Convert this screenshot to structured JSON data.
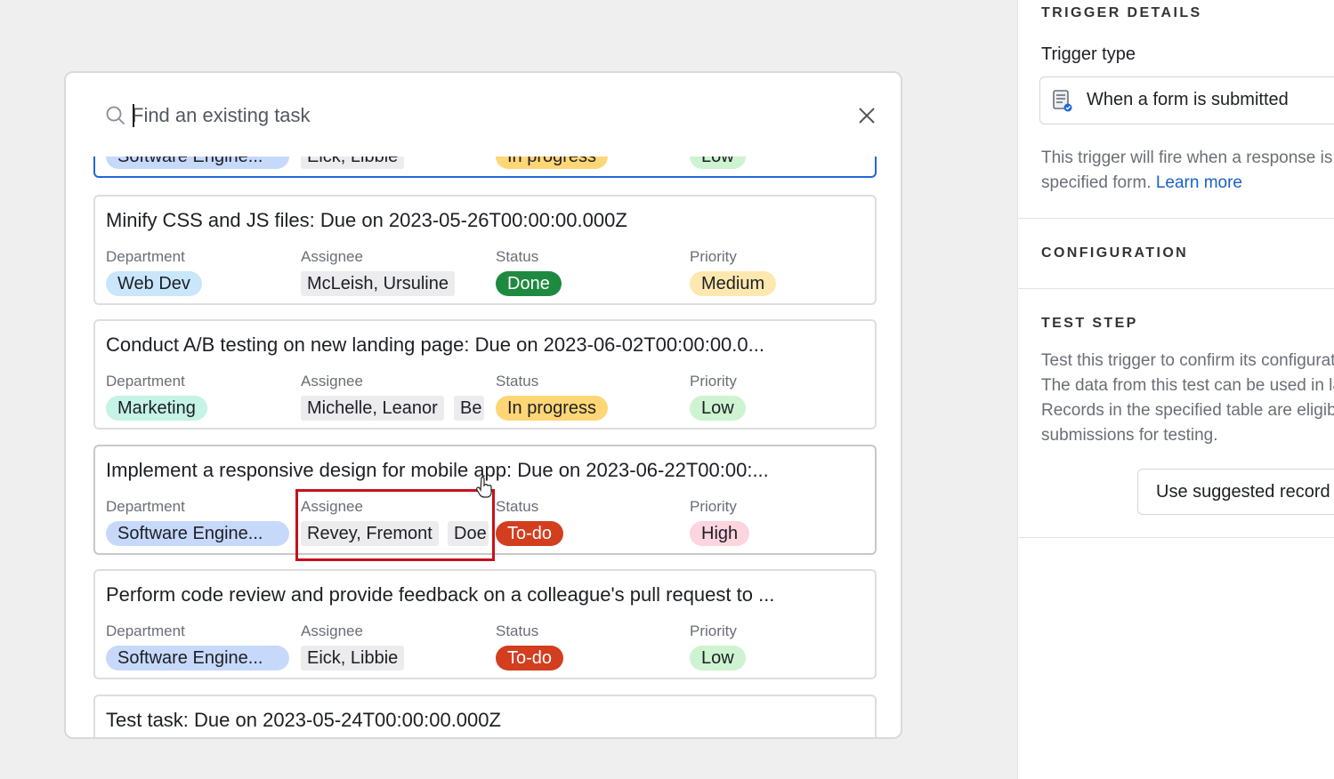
{
  "modal": {
    "search_placeholder": "Find an existing task",
    "tasks": [
      {
        "title": "",
        "department": "Software Engine...",
        "assignee": "Eick, Libbie",
        "assignee_more": "",
        "status": "In progress",
        "priority": "Low"
      },
      {
        "title": "Minify CSS and JS files: Due on 2023-05-26T00:00:00.000Z",
        "department": "Web Dev",
        "assignee": "McLeish, Ursuline",
        "assignee_more": "",
        "status": "Done",
        "priority": "Medium"
      },
      {
        "title": "Conduct A/B testing on new landing page: Due on 2023-06-02T00:00:00.0...",
        "department": "Marketing",
        "assignee": "Michelle, Leanor",
        "assignee_more": "Be",
        "status": "In progress",
        "priority": "Low"
      },
      {
        "title": "Implement a responsive design for mobile app: Due on 2023-06-22T00:00:...",
        "department": "Software Engine...",
        "assignee": "Revey, Fremont",
        "assignee_more": "Doe",
        "status": "To-do",
        "priority": "High"
      },
      {
        "title": "Perform code review and provide feedback on a colleague's pull request to ...",
        "department": "Software Engine...",
        "assignee": "Eick, Libbie",
        "assignee_more": "",
        "status": "To-do",
        "priority": "Low"
      },
      {
        "title": "Test task: Due on 2023-05-24T00:00:00.000Z"
      }
    ],
    "labels": {
      "department": "Department",
      "assignee": "Assignee",
      "status": "Status",
      "priority": "Priority"
    }
  },
  "side_panel": {
    "trigger_details_heading": "TRIGGER DETAILS",
    "trigger_type_label": "Trigger type",
    "trigger_type_value": "When a form is submitted",
    "trigger_type_icon": "form-icon",
    "description_line1": "This trigger will fire when a response is submitted to the",
    "description_line2": "specified form.",
    "learn_more": "Learn more",
    "configuration_heading": "CONFIGURATION",
    "test_step_heading": "TEST STEP",
    "test_line1": "Test this trigger to confirm its configuration is correct.",
    "test_line2": "The data from this test can be used in later steps.",
    "test_line3": "Records in the specified table are eligible as",
    "test_line4": "submissions for testing.",
    "suggest_button": "Use suggested record"
  },
  "colors": {
    "selected_border": "#1f67d8",
    "highlight": "#c8101c",
    "status_done": "#1e8a40",
    "status_todo": "#d23e1e",
    "status_in_progress": "#ffd676"
  }
}
